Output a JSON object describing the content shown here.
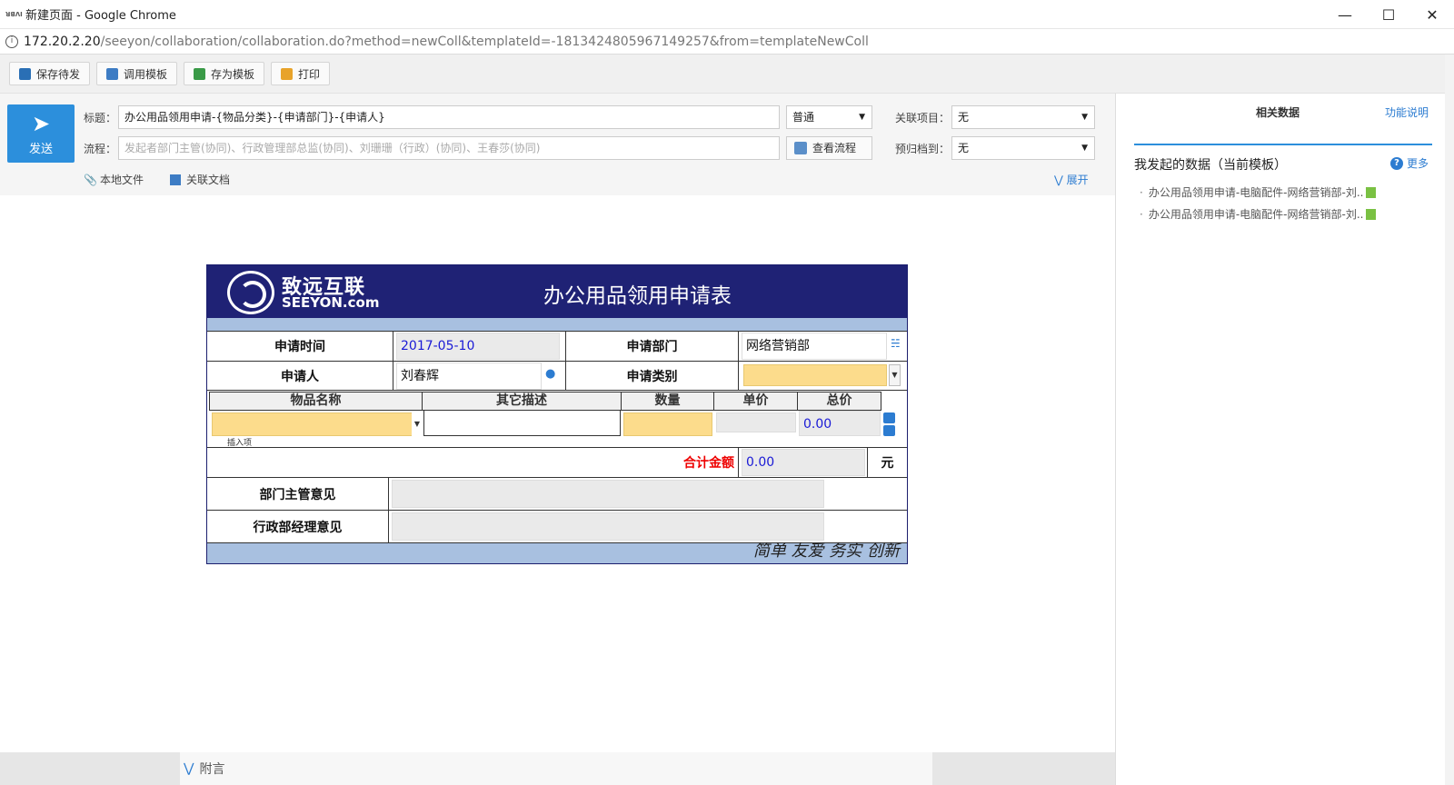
{
  "window": {
    "title": "新建页面 - Google Chrome",
    "favicon_text": "ꓤꓭꓥꓲ",
    "url_host": "172.20.2.20",
    "url_path": "/seeyon/collaboration/collaboration.do?method=newColl&templateId=-1813424805967149257&from=templateNewColl"
  },
  "toolbar": {
    "save_pending": "保存待发",
    "use_template": "调用模板",
    "save_template": "存为模板",
    "print": "打印"
  },
  "header": {
    "send_label": "发送",
    "title_label": "标题：",
    "title_value": "办公用品领用申请-{物品分类}-{申请部门}-{申请人}",
    "priority_value": "普通",
    "related_project_label": "关联项目：",
    "related_project_value": "无",
    "flow_label": "流程：",
    "flow_placeholder": "发起者部门主管(协同)、行政管理部总监(协同)、刘珊珊（行政）(协同)、王春莎(协同)",
    "view_flow": "查看流程",
    "archive_label": "预归档到：",
    "archive_value": "无",
    "local_file": "本地文件",
    "related_doc": "关联文档",
    "expand": "展开"
  },
  "form": {
    "logo_cn": "致远互联",
    "logo_en": "SEEYON.com",
    "title": "办公用品领用申请表",
    "apply_time_label": "申请时间",
    "apply_time_value": "2017-05-10",
    "apply_dept_label": "申请部门",
    "apply_dept_value": "网络营销部",
    "applicant_label": "申请人",
    "applicant_value": "刘春辉",
    "apply_type_label": "申请类别",
    "col_item_name": "物品名称",
    "col_other_desc": "其它描述",
    "col_qty": "数量",
    "col_unit_price": "单价",
    "col_total": "总价",
    "row_total_value": "0.00",
    "insert_item": "插入项",
    "sum_label": "合计金额",
    "sum_value": "0.00",
    "yuan": "元",
    "dept_opinion_label": "部门主管意见",
    "admin_opinion_label": "行政部经理意见",
    "slogan": "简单 友爱 务实 创新"
  },
  "right_panel": {
    "tab_related": "相关数据",
    "tab_help": "功能说明",
    "section_title": "我发起的数据（当前模板）",
    "more": "更多",
    "items": [
      "办公用品领用申请-电脑配件-网络营销部-刘..",
      "办公用品领用申请-电脑配件-网络营销部-刘.."
    ]
  },
  "bottom": {
    "fuyan": "附言"
  }
}
